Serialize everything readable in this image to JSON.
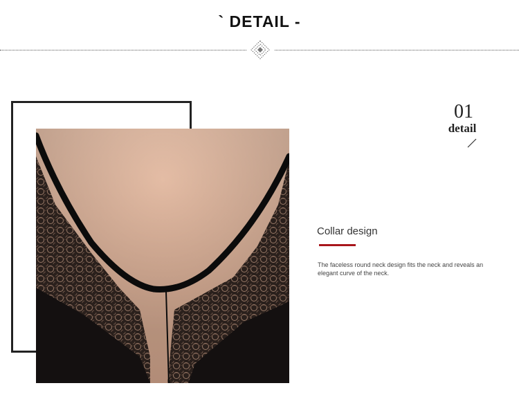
{
  "header": {
    "title": "` DETAIL -"
  },
  "detail": {
    "number": "01",
    "word": "detail"
  },
  "feature": {
    "title": "Collar design",
    "description": "The faceless round neck design fits the neck and reveals an elegant curve of the neck."
  },
  "colors": {
    "accent": "#a8151b",
    "text": "#222222",
    "background": "#ffffff"
  },
  "icons": {
    "ornament": "diamond-ornament-icon",
    "slash": "slash-icon"
  }
}
